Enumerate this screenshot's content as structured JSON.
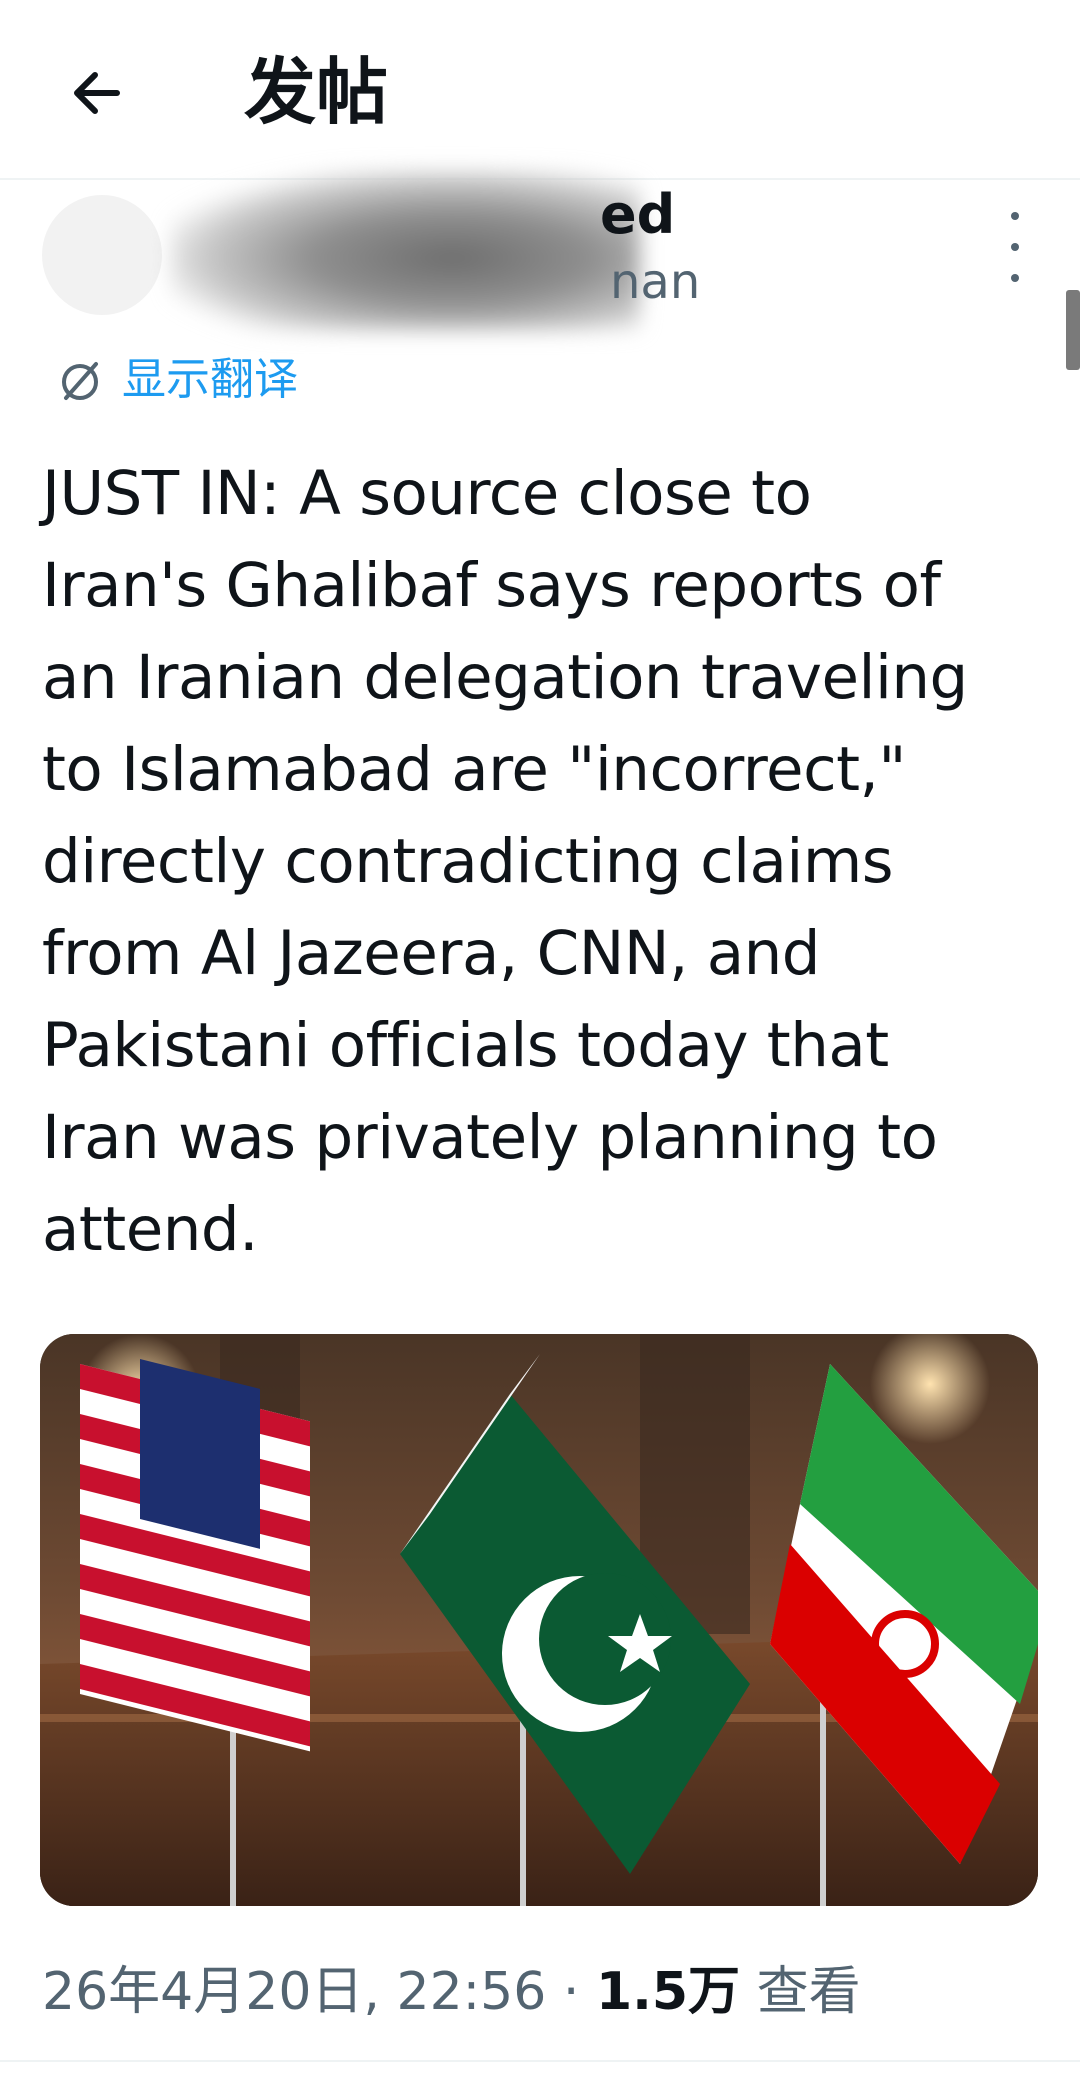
{
  "header": {
    "title": "发帖",
    "back_icon": "arrow-left-icon"
  },
  "author": {
    "name_visible": "ed",
    "handle_visible": "nan"
  },
  "translate": {
    "label": "显示翻译",
    "icon": "translate-icon"
  },
  "tweet": {
    "text": "JUST IN: A source close to\nIran's Ghalibaf says reports of\nan Iranian delegation traveling\nto Islamabad are \"incorrect,\"\ndirectly contradicting claims\nfrom Al Jazeera, CNN, and\nPakistani officials today that\nIran was privately planning to\nattend."
  },
  "meta": {
    "timestamp": "26年4月20日, 22:56",
    "separator": " · ",
    "views_count": "1.5万",
    "views_label": " 查看"
  },
  "colors": {
    "accent": "#1d9bf0",
    "text_primary": "#0f1419",
    "text_secondary": "#536471",
    "divider": "#eff3f4"
  }
}
